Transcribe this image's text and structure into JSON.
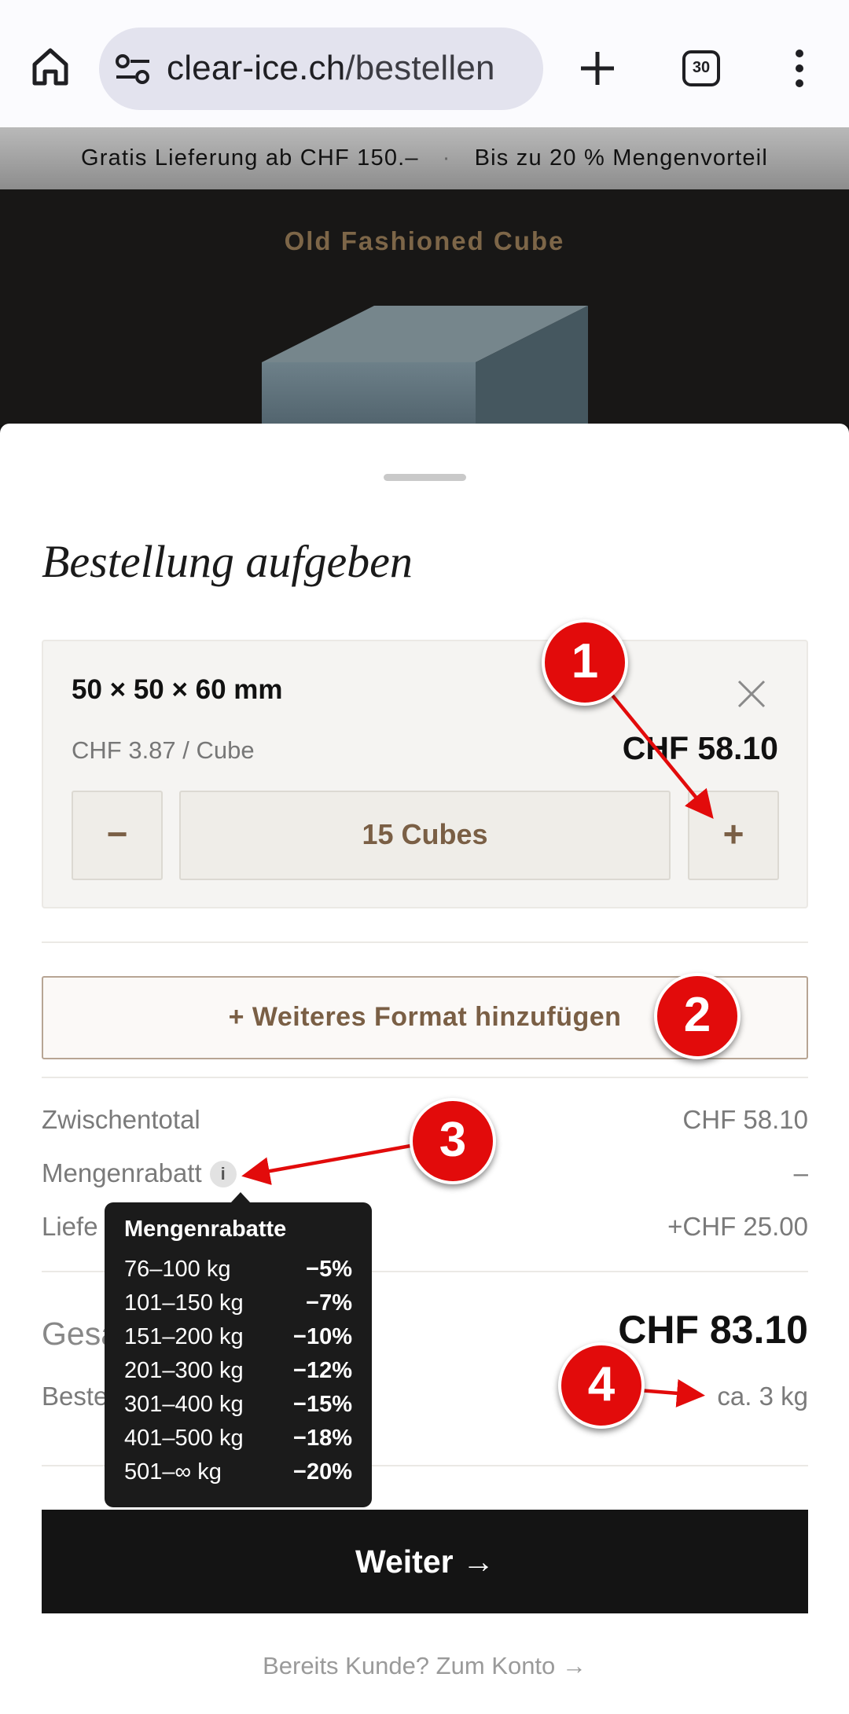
{
  "browser": {
    "url_domain": "clear-ice.ch",
    "url_path": "/bestellen",
    "tab_count": "30"
  },
  "promo": {
    "left": "Gratis Lieferung ab CHF 150.–",
    "separator": "·",
    "right": "Bis zu 20 % Mengenvorteil"
  },
  "background_page": {
    "product_title": "Old Fashioned Cube"
  },
  "sheet": {
    "title": "Bestellung aufgeben",
    "item": {
      "format": "50 × 50 × 60 mm",
      "unit_price": "CHF 3.87 / Cube",
      "line_total": "CHF 58.10",
      "minus_label": "−",
      "plus_label": "+",
      "quantity_label": "15 Cubes"
    },
    "add_format_label": "+ Weiteres Format hinzufügen",
    "summary": {
      "subtotal_label": "Zwischentotal",
      "subtotal_value": "CHF 58.10",
      "discount_label": "Mengenrabatt",
      "discount_value": "–",
      "delivery_label_visible": "Liefe",
      "delivery_value": "+CHF 25.00",
      "total_label_visible": "Gesa",
      "total_value": "CHF 83.10",
      "weight_label_visible": "Beste",
      "weight_value": "ca. 3 kg"
    },
    "continue_label": "Weiter →",
    "account_link": "Bereits Kunde? Zum Konto →"
  },
  "tooltip": {
    "title": "Mengenrabatte",
    "tiers": [
      {
        "range": "76–100 kg",
        "discount": "−5%"
      },
      {
        "range": "101–150 kg",
        "discount": "−7%"
      },
      {
        "range": "151–200 kg",
        "discount": "−10%"
      },
      {
        "range": "201–300 kg",
        "discount": "−12%"
      },
      {
        "range": "301–400 kg",
        "discount": "−15%"
      },
      {
        "range": "401–500 kg",
        "discount": "−18%"
      },
      {
        "range": "501–∞ kg",
        "discount": "−20%"
      }
    ]
  },
  "annotations": [
    "1",
    "2",
    "3",
    "4"
  ],
  "colors": {
    "accent_brown": "#7a5f45",
    "annotation_red": "#e20b0b",
    "button_dark": "#141414"
  },
  "icons": [
    "home-icon",
    "site-settings-icon",
    "new-tab-icon",
    "tab-switcher-icon",
    "more-menu-icon",
    "close-icon",
    "info-icon"
  ]
}
